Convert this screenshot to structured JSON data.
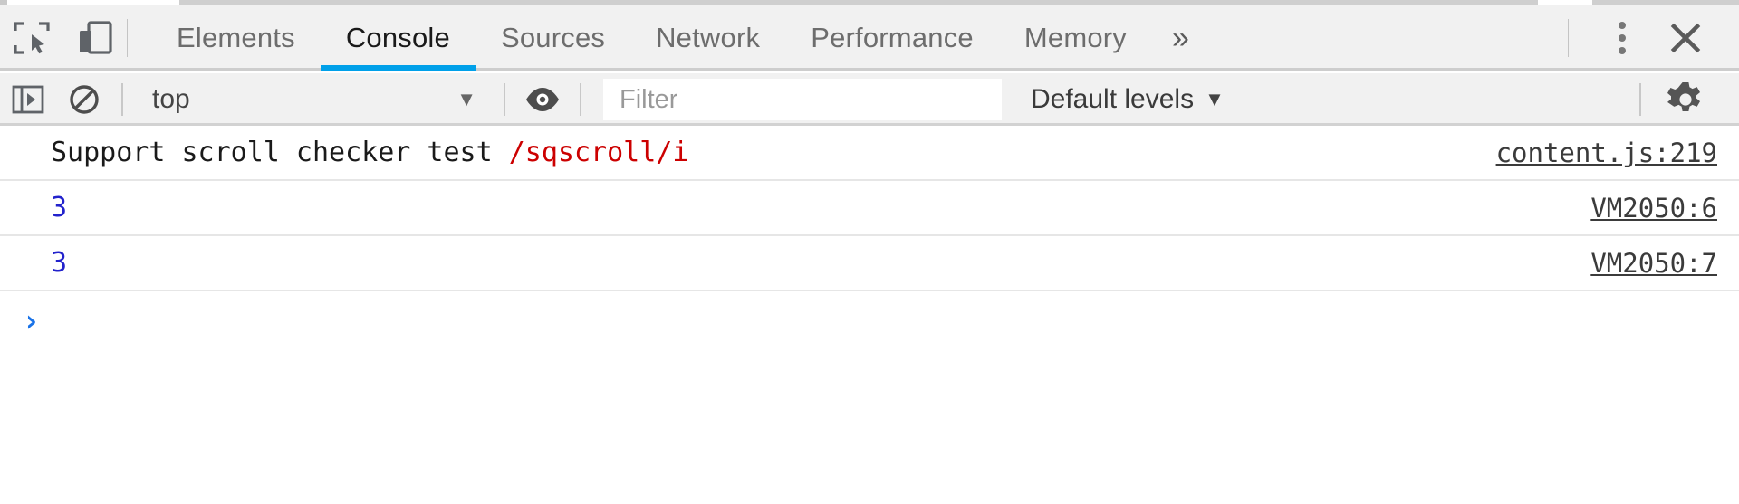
{
  "toolbar": {
    "inspect_icon": "inspect-element-icon",
    "device_icon": "device-toolbar-icon",
    "menu_icon": "more-options-icon",
    "close_icon": "close-icon",
    "overflow_label": "»"
  },
  "tabs": [
    {
      "label": "Elements",
      "active": false
    },
    {
      "label": "Console",
      "active": true
    },
    {
      "label": "Sources",
      "active": false
    },
    {
      "label": "Network",
      "active": false
    },
    {
      "label": "Performance",
      "active": false
    },
    {
      "label": "Memory",
      "active": false
    }
  ],
  "filterbar": {
    "sidebar_icon": "console-sidebar-icon",
    "clear_icon": "clear-console-icon",
    "eye_icon": "live-expression-eye-icon",
    "gear_icon": "settings-gear-icon",
    "context_value": "top",
    "context_arrow": "▼",
    "filter_placeholder": "Filter",
    "filter_value": "",
    "levels_label": "Default levels",
    "levels_arrow": "▼"
  },
  "console": {
    "messages": [
      {
        "text_plain": "Support scroll checker test ",
        "text_regex": "/sqscroll/i",
        "source": "content.js:219",
        "kind": "log"
      },
      {
        "text_plain": "3",
        "text_regex": "",
        "source": "VM2050:6",
        "kind": "number"
      },
      {
        "text_plain": "3",
        "text_regex": "",
        "source": "VM2050:7",
        "kind": "number"
      }
    ],
    "prompt_caret": "›"
  },
  "colors": {
    "accent_blue": "#00a0e9",
    "regex_red": "#cc0000",
    "number_blue": "#2222cc",
    "chrome_bg": "#f1f1f1"
  }
}
